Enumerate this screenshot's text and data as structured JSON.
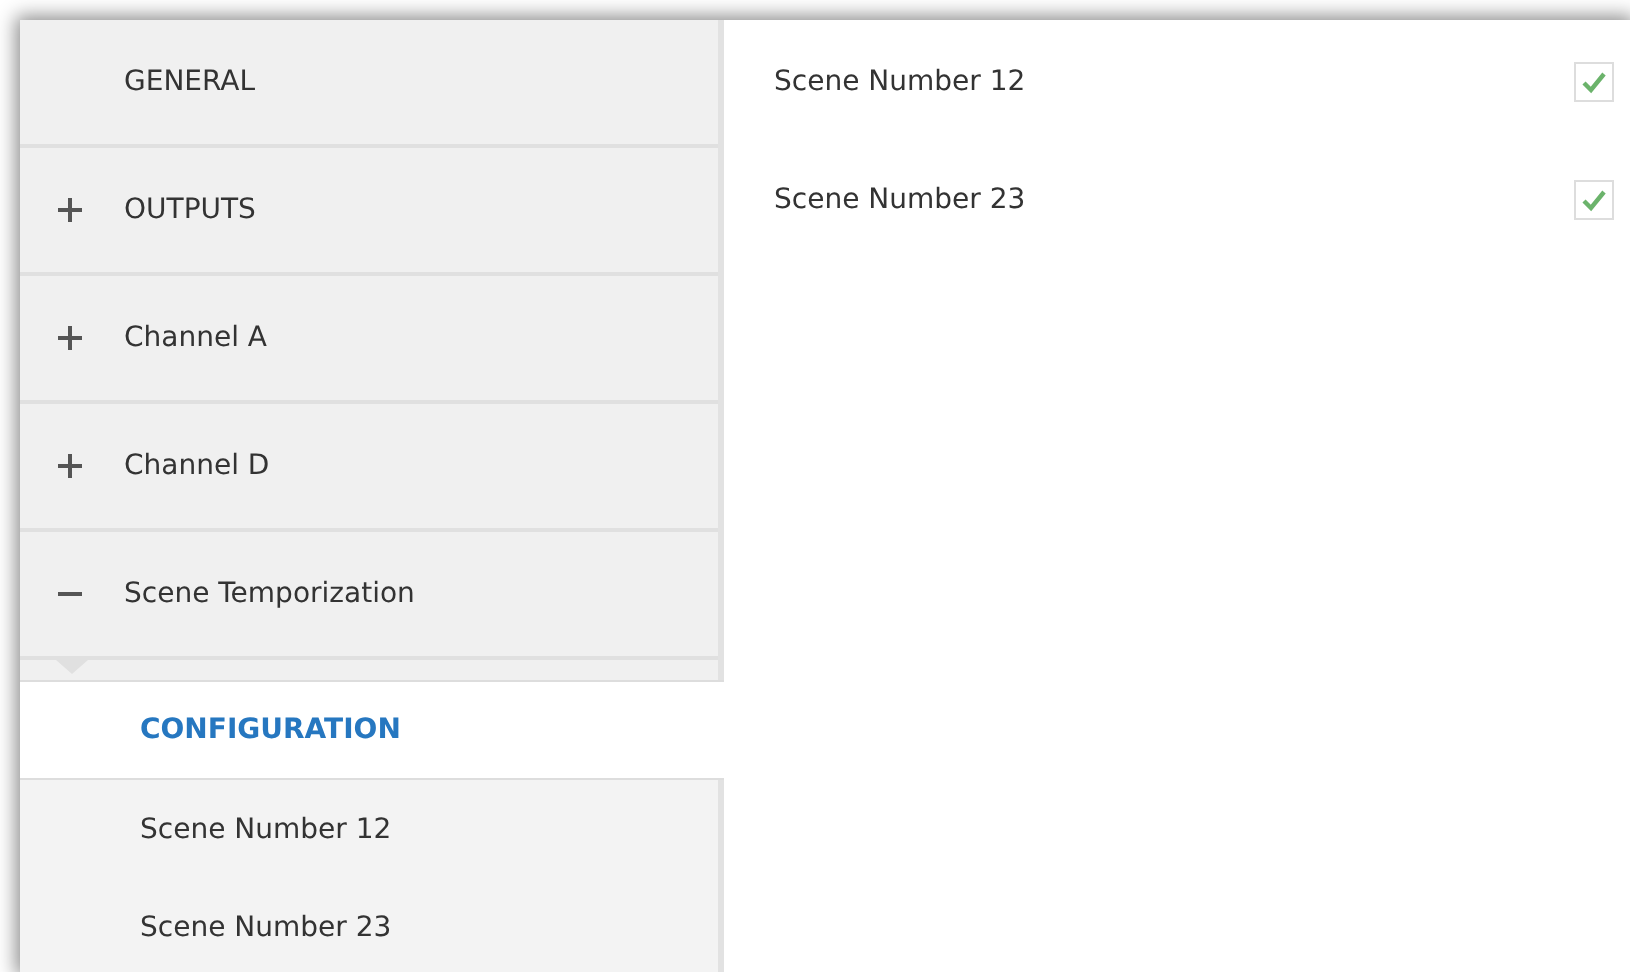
{
  "sidebar": {
    "items": [
      {
        "label": "GENERAL",
        "kind": "leaf"
      },
      {
        "label": "OUTPUTS",
        "kind": "group",
        "expanded": false
      },
      {
        "label": "Channel A",
        "kind": "group",
        "expanded": false
      },
      {
        "label": "Channel D",
        "kind": "group",
        "expanded": false
      },
      {
        "label": "Scene Temporization",
        "kind": "group",
        "expanded": true,
        "children": [
          {
            "label": "CONFIGURATION",
            "selected": true
          },
          {
            "label": "Scene Number 12",
            "selected": false
          },
          {
            "label": "Scene Number 23",
            "selected": false
          }
        ]
      }
    ]
  },
  "settings": [
    {
      "label": "Scene Number 12",
      "checked": true
    },
    {
      "label": "Scene Number 23",
      "checked": true
    }
  ]
}
